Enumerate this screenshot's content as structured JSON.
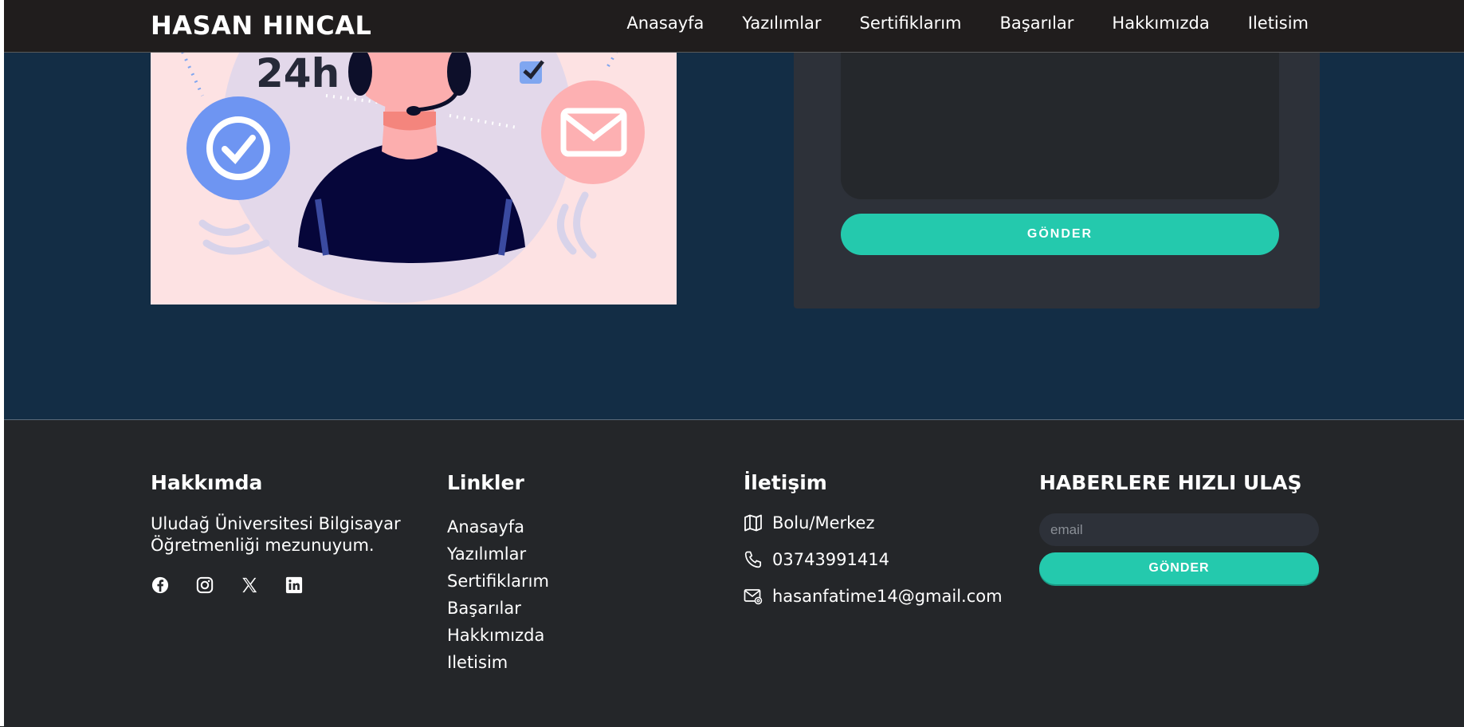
{
  "navbar": {
    "brand": "HASAN HINCAL",
    "links": [
      "Anasayfa",
      "Yazılımlar",
      "Sertifiklarım",
      "Başarılar",
      "Hakkımızda",
      "Iletisim"
    ]
  },
  "hero": {
    "badge_text": "24h"
  },
  "contact_form": {
    "submit_label": "GÖNDER"
  },
  "footer": {
    "about": {
      "title": "Hakkımda",
      "text": "Uludağ Üniversitesi Bilgisayar Öğretmenliği mezunuyum.",
      "socials": [
        "facebook-icon",
        "instagram-icon",
        "x-icon",
        "linkedin-icon"
      ]
    },
    "links": {
      "title": "Linkler",
      "items": [
        "Anasayfa",
        "Yazılımlar",
        "Sertifiklarım",
        "Başarılar",
        "Hakkımızda",
        "Iletisim"
      ]
    },
    "contact": {
      "title": "İletişim",
      "location": "Bolu/Merkez",
      "phone": "03743991414",
      "email": "hasanfatime14@gmail.com"
    },
    "newsletter": {
      "title": "HABERLERE HIZLI ULAŞ",
      "placeholder": "email",
      "button_label": "GÖNDER"
    }
  },
  "colors": {
    "accent": "#24c9ad",
    "navbar_bg": "#201d1d",
    "section_bg": "#132d45",
    "footer_bg": "#242629"
  }
}
